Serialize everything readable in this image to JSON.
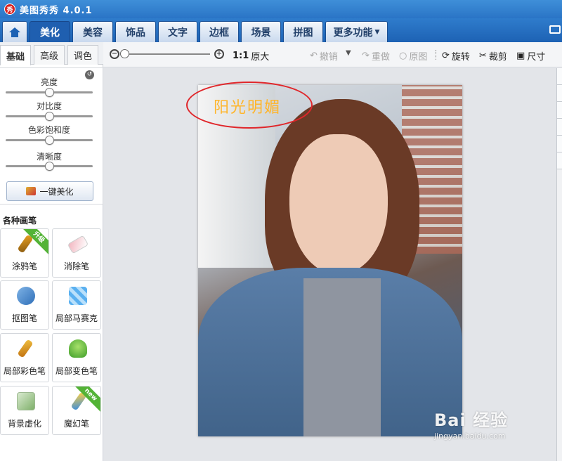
{
  "app": {
    "title": "美图秀秀 4.0.1",
    "icon_text": "秀"
  },
  "nav": {
    "tabs": [
      {
        "label": "美化"
      },
      {
        "label": "美容"
      },
      {
        "label": "饰品"
      },
      {
        "label": "文字"
      },
      {
        "label": "边框"
      },
      {
        "label": "场景"
      },
      {
        "label": "拼图"
      },
      {
        "label": "更多功能"
      }
    ],
    "active": "美化"
  },
  "toolbar": {
    "actual_size_prefix": "1:1",
    "actual_size": "原大",
    "undo": "撤销",
    "redo": "重做",
    "original": "原图",
    "rotate": "旋转",
    "crop": "裁剪",
    "size": "尺寸",
    "zoom_level": 0
  },
  "left_panel": {
    "subtabs": [
      "基础",
      "高级",
      "调色"
    ],
    "active_subtab": "基础",
    "sliders": [
      {
        "label": "亮度",
        "value": 0.5
      },
      {
        "label": "对比度",
        "value": 0.5
      },
      {
        "label": "色彩饱和度",
        "value": 0.5
      },
      {
        "label": "清晰度",
        "value": 0.5
      }
    ],
    "onekey_button": "一键美化",
    "brush_section_title": "各种画笔",
    "brushes": [
      {
        "label": "涂鸦笔",
        "badge": "升级",
        "icon": "doodle-brush-icon"
      },
      {
        "label": "消除笔",
        "badge": "",
        "icon": "eraser-icon"
      },
      {
        "label": "抠图笔",
        "badge": "",
        "icon": "cutout-pen-icon"
      },
      {
        "label": "局部马赛克",
        "badge": "",
        "icon": "mosaic-icon"
      },
      {
        "label": "局部彩色笔",
        "badge": "",
        "icon": "color-brush-icon"
      },
      {
        "label": "局部变色笔",
        "badge": "",
        "icon": "recolor-brush-icon"
      },
      {
        "label": "背景虚化",
        "badge": "",
        "icon": "background-blur-icon"
      },
      {
        "label": "魔幻笔",
        "badge": "new",
        "icon": "magic-pen-icon"
      }
    ]
  },
  "canvas": {
    "overlay_text": "阳光明媚"
  },
  "watermark": {
    "main": "Bai 经验",
    "sub": "jingyan.baidu.com"
  },
  "colors": {
    "title_bar": "#2a74c6",
    "active_tab": "#1f5fb0",
    "overlay_text": "#ffb52a",
    "annotation_ring": "#e0262a",
    "badge": "#53b336"
  }
}
